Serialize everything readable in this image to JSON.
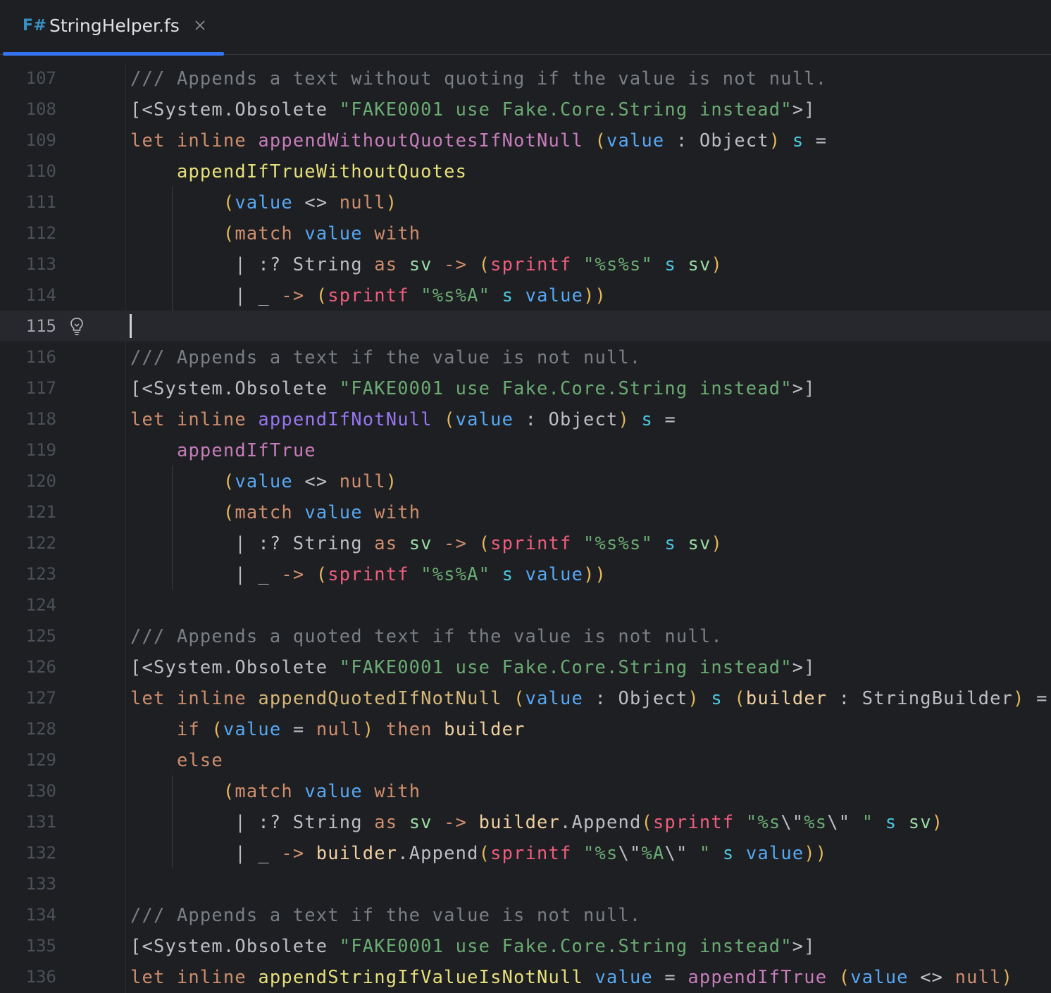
{
  "tab": {
    "lang_badge": "F#",
    "title": "StringHelper.fs",
    "close_icon": "close-icon"
  },
  "editor": {
    "caret_line": "115",
    "gutter_icon": "lightbulb-icon",
    "lines": [
      {
        "n": "107",
        "tokens": [
          [
            "cm",
            "/// Appends a text without quoting if the value is not null."
          ]
        ]
      },
      {
        "n": "108",
        "tokens": [
          [
            "op",
            "[<System.Obsolete "
          ],
          [
            "st",
            "\"FAKE0001 use Fake.Core.String instead\""
          ],
          [
            "op",
            ">]"
          ]
        ]
      },
      {
        "n": "109",
        "tokens": [
          [
            "kw",
            "let inline "
          ],
          [
            "fnp",
            "appendWithoutQuotesIfNotNull"
          ],
          [
            "op",
            " "
          ],
          [
            "br",
            "("
          ],
          [
            "fnb",
            "value"
          ],
          [
            "op",
            " : Object"
          ],
          [
            "br",
            ")"
          ],
          [
            "op",
            " "
          ],
          [
            "vr",
            "s"
          ],
          [
            "op",
            " ="
          ]
        ]
      },
      {
        "n": "110",
        "tokens": [
          [
            "op",
            "    "
          ],
          [
            "fnl",
            "appendIfTrueWithoutQuotes"
          ]
        ]
      },
      {
        "n": "111",
        "tokens": [
          [
            "op",
            "        "
          ],
          [
            "br",
            "("
          ],
          [
            "fnb",
            "value"
          ],
          [
            "op",
            " <> "
          ],
          [
            "kw",
            "null"
          ],
          [
            "br",
            ")"
          ]
        ]
      },
      {
        "n": "112",
        "tokens": [
          [
            "op",
            "        "
          ],
          [
            "br",
            "("
          ],
          [
            "kw",
            "match "
          ],
          [
            "fnb",
            "value"
          ],
          [
            "kw",
            " with"
          ]
        ]
      },
      {
        "n": "113",
        "tokens": [
          [
            "op",
            "         | :? String "
          ],
          [
            "kw",
            "as "
          ],
          [
            "lc",
            "sv"
          ],
          [
            "kw",
            " -> "
          ],
          [
            "br",
            "("
          ],
          [
            "ca",
            "sprintf"
          ],
          [
            "op",
            " "
          ],
          [
            "st",
            "\"%s%s\""
          ],
          [
            "op",
            " "
          ],
          [
            "vr",
            "s"
          ],
          [
            "op",
            " "
          ],
          [
            "lc",
            "sv"
          ],
          [
            "br",
            ")"
          ]
        ]
      },
      {
        "n": "114",
        "tokens": [
          [
            "op",
            "         | _ "
          ],
          [
            "kw",
            "-> "
          ],
          [
            "br",
            "("
          ],
          [
            "ca",
            "sprintf"
          ],
          [
            "op",
            " "
          ],
          [
            "st",
            "\"%s%A\""
          ],
          [
            "op",
            " "
          ],
          [
            "vr",
            "s"
          ],
          [
            "op",
            " "
          ],
          [
            "fnb",
            "value"
          ],
          [
            "br",
            "))"
          ]
        ]
      },
      {
        "n": "115",
        "tokens": []
      },
      {
        "n": "116",
        "tokens": [
          [
            "cm",
            "/// Appends a text if the value is not null."
          ]
        ]
      },
      {
        "n": "117",
        "tokens": [
          [
            "op",
            "[<System.Obsolete "
          ],
          [
            "st",
            "\"FAKE0001 use Fake.Core.String instead\""
          ],
          [
            "op",
            ">]"
          ]
        ]
      },
      {
        "n": "118",
        "tokens": [
          [
            "kw",
            "let inline "
          ],
          [
            "fnpu",
            "appendIfNotNull"
          ],
          [
            "op",
            " "
          ],
          [
            "br",
            "("
          ],
          [
            "fnb",
            "value"
          ],
          [
            "op",
            " : Object"
          ],
          [
            "br",
            ")"
          ],
          [
            "op",
            " "
          ],
          [
            "vr",
            "s"
          ],
          [
            "op",
            " ="
          ]
        ]
      },
      {
        "n": "119",
        "tokens": [
          [
            "op",
            "    "
          ],
          [
            "fnp",
            "appendIfTrue"
          ]
        ]
      },
      {
        "n": "120",
        "tokens": [
          [
            "op",
            "        "
          ],
          [
            "br",
            "("
          ],
          [
            "fnb",
            "value"
          ],
          [
            "op",
            " <> "
          ],
          [
            "kw",
            "null"
          ],
          [
            "br",
            ")"
          ]
        ]
      },
      {
        "n": "121",
        "tokens": [
          [
            "op",
            "        "
          ],
          [
            "br",
            "("
          ],
          [
            "kw",
            "match "
          ],
          [
            "fnb",
            "value"
          ],
          [
            "kw",
            " with"
          ]
        ]
      },
      {
        "n": "122",
        "tokens": [
          [
            "op",
            "         | :? String "
          ],
          [
            "kw",
            "as "
          ],
          [
            "lc",
            "sv"
          ],
          [
            "kw",
            " -> "
          ],
          [
            "br",
            "("
          ],
          [
            "ca",
            "sprintf"
          ],
          [
            "op",
            " "
          ],
          [
            "st",
            "\"%s%s\""
          ],
          [
            "op",
            " "
          ],
          [
            "vr",
            "s"
          ],
          [
            "op",
            " "
          ],
          [
            "lc",
            "sv"
          ],
          [
            "br",
            ")"
          ]
        ]
      },
      {
        "n": "123",
        "tokens": [
          [
            "op",
            "         | _ "
          ],
          [
            "kw",
            "-> "
          ],
          [
            "br",
            "("
          ],
          [
            "ca",
            "sprintf"
          ],
          [
            "op",
            " "
          ],
          [
            "st",
            "\"%s%A\""
          ],
          [
            "op",
            " "
          ],
          [
            "vr",
            "s"
          ],
          [
            "op",
            " "
          ],
          [
            "fnb",
            "value"
          ],
          [
            "br",
            "))"
          ]
        ]
      },
      {
        "n": "124",
        "tokens": []
      },
      {
        "n": "125",
        "tokens": [
          [
            "cm",
            "/// Appends a quoted text if the value is not null."
          ]
        ]
      },
      {
        "n": "126",
        "tokens": [
          [
            "op",
            "[<System.Obsolete "
          ],
          [
            "st",
            "\"FAKE0001 use Fake.Core.String instead\""
          ],
          [
            "op",
            ">]"
          ]
        ]
      },
      {
        "n": "127",
        "tokens": [
          [
            "kw",
            "let inline "
          ],
          [
            "fn",
            "appendQuotedIfNotNull"
          ],
          [
            "op",
            " "
          ],
          [
            "br",
            "("
          ],
          [
            "fnb",
            "value"
          ],
          [
            "op",
            " : Object"
          ],
          [
            "br",
            ")"
          ],
          [
            "op",
            " "
          ],
          [
            "vr",
            "s"
          ],
          [
            "op",
            " "
          ],
          [
            "br",
            "("
          ],
          [
            "bl",
            "builder"
          ],
          [
            "op",
            " : StringBuilder"
          ],
          [
            "br",
            ")"
          ],
          [
            "op",
            " ="
          ]
        ]
      },
      {
        "n": "128",
        "tokens": [
          [
            "op",
            "    "
          ],
          [
            "kw",
            "if "
          ],
          [
            "br",
            "("
          ],
          [
            "fnb",
            "value"
          ],
          [
            "op",
            " = "
          ],
          [
            "kw",
            "null"
          ],
          [
            "br",
            ")"
          ],
          [
            "kw",
            " then "
          ],
          [
            "bl",
            "builder"
          ]
        ]
      },
      {
        "n": "129",
        "tokens": [
          [
            "op",
            "    "
          ],
          [
            "kw",
            "else"
          ]
        ]
      },
      {
        "n": "130",
        "tokens": [
          [
            "op",
            "        "
          ],
          [
            "br",
            "("
          ],
          [
            "kw",
            "match "
          ],
          [
            "fnb",
            "value"
          ],
          [
            "kw",
            " with"
          ]
        ]
      },
      {
        "n": "131",
        "tokens": [
          [
            "op",
            "         | :? String "
          ],
          [
            "kw",
            "as "
          ],
          [
            "lc",
            "sv"
          ],
          [
            "kw",
            " -> "
          ],
          [
            "bl",
            "builder"
          ],
          [
            "op",
            ".Append"
          ],
          [
            "br",
            "("
          ],
          [
            "ca",
            "sprintf"
          ],
          [
            "op",
            " "
          ],
          [
            "st",
            "\"%s"
          ],
          [
            "op",
            "\\\""
          ],
          [
            "st",
            "%s"
          ],
          [
            "op",
            "\\\""
          ],
          [
            "st",
            " \""
          ],
          [
            "op",
            " "
          ],
          [
            "vr",
            "s"
          ],
          [
            "op",
            " "
          ],
          [
            "lc",
            "sv"
          ],
          [
            "br",
            ")"
          ]
        ]
      },
      {
        "n": "132",
        "tokens": [
          [
            "op",
            "         | _ "
          ],
          [
            "kw",
            "-> "
          ],
          [
            "bl",
            "builder"
          ],
          [
            "op",
            ".Append"
          ],
          [
            "br",
            "("
          ],
          [
            "ca",
            "sprintf"
          ],
          [
            "op",
            " "
          ],
          [
            "st",
            "\"%s"
          ],
          [
            "op",
            "\\\""
          ],
          [
            "st",
            "%A"
          ],
          [
            "op",
            "\\\""
          ],
          [
            "st",
            " \""
          ],
          [
            "op",
            " "
          ],
          [
            "vr",
            "s"
          ],
          [
            "op",
            " "
          ],
          [
            "fnb",
            "value"
          ],
          [
            "br",
            "))"
          ]
        ]
      },
      {
        "n": "133",
        "tokens": []
      },
      {
        "n": "134",
        "tokens": [
          [
            "cm",
            "/// Appends a text if the value is not null."
          ]
        ]
      },
      {
        "n": "135",
        "tokens": [
          [
            "op",
            "[<System.Obsolete "
          ],
          [
            "st",
            "\"FAKE0001 use Fake.Core.String instead\""
          ],
          [
            "op",
            ">]"
          ]
        ]
      },
      {
        "n": "136",
        "tokens": [
          [
            "kw",
            "let inline "
          ],
          [
            "fnl",
            "appendStringIfValueIsNotNull"
          ],
          [
            "op",
            " "
          ],
          [
            "fnb",
            "value"
          ],
          [
            "op",
            " = "
          ],
          [
            "fnp",
            "appendIfTrue"
          ],
          [
            "op",
            " "
          ],
          [
            "br",
            "("
          ],
          [
            "fnb",
            "value"
          ],
          [
            "op",
            " <> "
          ],
          [
            "kw",
            "null"
          ],
          [
            "br",
            ")"
          ]
        ]
      }
    ]
  }
}
